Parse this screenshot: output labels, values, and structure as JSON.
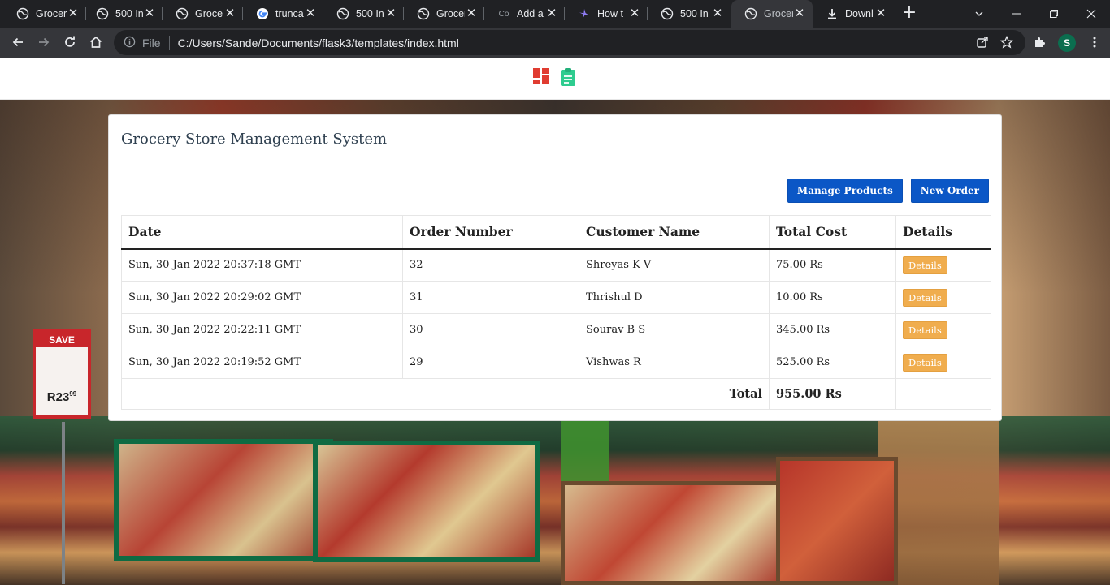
{
  "browser": {
    "tabs": [
      {
        "title": "Grocer",
        "icon": "globe-icon",
        "active": false
      },
      {
        "title": "500 In",
        "icon": "globe-icon",
        "active": false
      },
      {
        "title": "Grocer",
        "icon": "globe-icon",
        "active": false
      },
      {
        "title": "trunca",
        "icon": "google-icon",
        "active": false
      },
      {
        "title": "500 In",
        "icon": "globe-icon",
        "active": false
      },
      {
        "title": "Grocer",
        "icon": "globe-icon",
        "active": false
      },
      {
        "title": "Add a",
        "icon": "co-icon",
        "icon_text": "Co",
        "active": false
      },
      {
        "title": "How t",
        "icon": "prop-icon",
        "active": false
      },
      {
        "title": "500 In",
        "icon": "globe-icon",
        "active": false
      },
      {
        "title": "Grocer",
        "icon": "globe-icon",
        "active": true
      },
      {
        "title": "Downl",
        "icon": "download-icon",
        "active": false
      }
    ],
    "address": {
      "info_label": "File",
      "url": "C:/Users/Sande/Documents/flask3/templates/index.html"
    },
    "profile_initial": "S",
    "colors": {
      "chrome_dark": "#202124",
      "chrome_toolbar": "#35363a",
      "profile": "#0b6e4f"
    }
  },
  "background": {
    "sign_label": "SAVE",
    "sign_price": "R23",
    "sign_price_cents": "99"
  },
  "navbar": {
    "icons": [
      "dashboard-icon",
      "clipboard-icon"
    ],
    "colors": {
      "dashboard": "#e03c31",
      "clipboard": "#2ecc8f"
    }
  },
  "card": {
    "title": "Grocery Store Management System",
    "buttons": {
      "manage_products": "Manage Products",
      "new_order": "New Order"
    },
    "table": {
      "headers": [
        "Date",
        "Order Number",
        "Customer Name",
        "Total Cost",
        "Details"
      ],
      "rows": [
        {
          "date": "Sun, 30 Jan 2022 20:37:18 GMT",
          "order_number": "32",
          "customer": "Shreyas K V",
          "total": "75.00 Rs",
          "details_label": "Details"
        },
        {
          "date": "Sun, 30 Jan 2022 20:29:02 GMT",
          "order_number": "31",
          "customer": "Thrishul D",
          "total": "10.00 Rs",
          "details_label": "Details"
        },
        {
          "date": "Sun, 30 Jan 2022 20:22:11 GMT",
          "order_number": "30",
          "customer": "Sourav B S",
          "total": "345.00 Rs",
          "details_label": "Details"
        },
        {
          "date": "Sun, 30 Jan 2022 20:19:52 GMT",
          "order_number": "29",
          "customer": "Vishwas R",
          "total": "525.00 Rs",
          "details_label": "Details"
        }
      ],
      "total_label": "Total",
      "total_value": "955.00 Rs"
    },
    "colors": {
      "primary_button": "#0b57c6",
      "details_button": "#f0ad4e",
      "title": "#2f4050"
    }
  }
}
